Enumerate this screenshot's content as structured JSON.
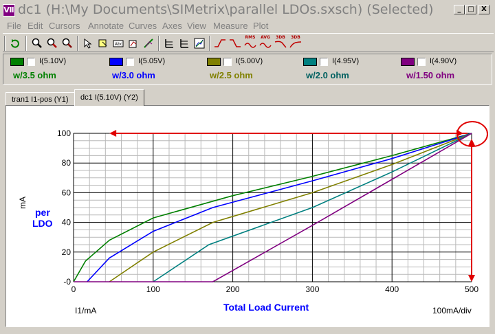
{
  "window": {
    "title": "dc1 (H:\\My Documents\\SIMetrix\\parallel LDOs.sxsch) (Selected)",
    "app_icon_text": "Ⅶ",
    "controls": {
      "minimize": "_",
      "maximize": "□",
      "close": "X"
    }
  },
  "menu": [
    "File",
    "Edit",
    "Cursors",
    "Annotate",
    "Curves",
    "Axes",
    "View",
    "Measure",
    "Plot"
  ],
  "toolbar": {
    "labels": {
      "rms": "RMS",
      "avg": "AVG",
      "db3": "3DB",
      "db3b": "3DB"
    }
  },
  "legend": [
    {
      "label": "I(5.10V)",
      "note": "w/3.5 ohm",
      "color": "#008000",
      "note_color": "#008000",
      "checked": false
    },
    {
      "label": "I(5.05V)",
      "note": "w/3.0 ohm",
      "color": "#0000ff",
      "note_color": "#0000ff",
      "checked": false
    },
    {
      "label": "I(5.00V)",
      "note": "w/2.5 ohm",
      "color": "#808000",
      "note_color": "#808000",
      "checked": false
    },
    {
      "label": "I(4.95V)",
      "note": "w/2.0 ohm",
      "color": "#008080",
      "note_color": "#006060",
      "checked": false
    },
    {
      "label": "I(4.90V)",
      "note": "w/1.50 ohm",
      "color": "#800080",
      "note_color": "#800080",
      "checked": false
    }
  ],
  "tabs": [
    {
      "label": "tran1 I1-pos (Y1)",
      "active": false
    },
    {
      "label": "dc1 I(5.10V) (Y2)",
      "active": true
    }
  ],
  "plot": {
    "y_unit": "mA",
    "y_annotation": [
      "per",
      "LDO"
    ],
    "x_axis_title": "Total Load Current",
    "x_signal": "I1/mA",
    "x_scale": "100mA/div",
    "annotation_color": "#e00000"
  },
  "chart_data": {
    "type": "line",
    "xlim": [
      0,
      500
    ],
    "ylim": [
      0,
      100
    ],
    "x_ticks": [
      0,
      100,
      200,
      300,
      400,
      500
    ],
    "y_ticks": [
      0,
      20,
      40,
      60,
      80,
      100
    ],
    "x_tick_labels": [
      "0",
      "100",
      "200",
      "300",
      "400",
      "500"
    ],
    "y_tick_labels": [
      "-0",
      "20",
      "40",
      "60",
      "80",
      "100"
    ],
    "grid": true,
    "series": [
      {
        "name": "I(5.10V)",
        "color": "#008000",
        "points": [
          [
            0,
            0
          ],
          [
            15,
            14
          ],
          [
            45,
            28
          ],
          [
            100,
            43
          ],
          [
            200,
            58
          ],
          [
            300,
            71
          ],
          [
            400,
            85
          ],
          [
            500,
            100
          ]
        ]
      },
      {
        "name": "I(5.05V)",
        "color": "#0000ff",
        "points": [
          [
            17,
            0
          ],
          [
            45,
            16
          ],
          [
            100,
            34
          ],
          [
            175,
            50
          ],
          [
            300,
            68
          ],
          [
            400,
            83
          ],
          [
            500,
            100
          ]
        ]
      },
      {
        "name": "I(5.00V)",
        "color": "#808000",
        "points": [
          [
            45,
            0
          ],
          [
            100,
            20
          ],
          [
            175,
            40
          ],
          [
            300,
            60
          ],
          [
            400,
            79
          ],
          [
            500,
            100
          ]
        ]
      },
      {
        "name": "I(4.95V)",
        "color": "#008080",
        "points": [
          [
            100,
            0
          ],
          [
            170,
            25
          ],
          [
            300,
            50
          ],
          [
            400,
            74
          ],
          [
            500,
            100
          ]
        ]
      },
      {
        "name": "I(4.90V)",
        "color": "#800080",
        "points": [
          [
            0,
            0
          ],
          [
            175,
            0
          ],
          [
            300,
            38
          ],
          [
            400,
            69
          ],
          [
            500,
            100
          ]
        ]
      }
    ]
  }
}
